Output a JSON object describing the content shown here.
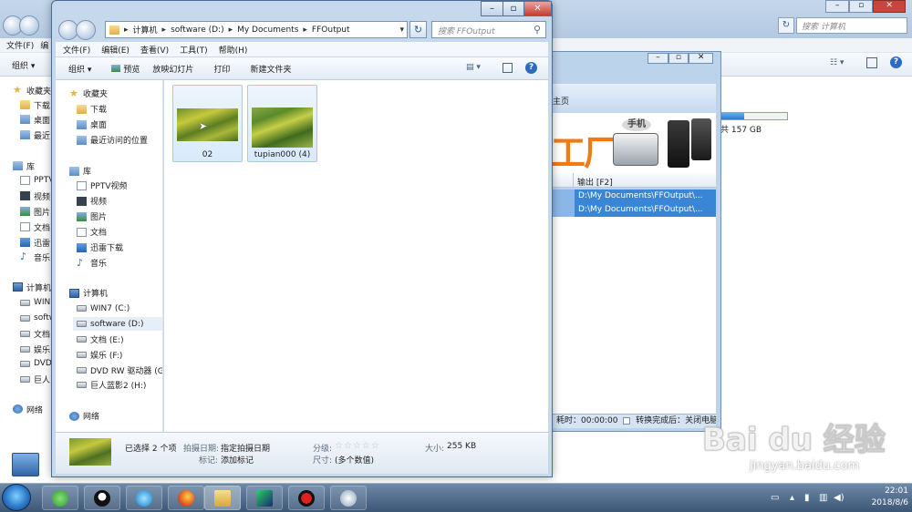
{
  "bg_window": {
    "menu": [
      "文件(F)",
      "编"
    ],
    "toolbar_org": "组织 ▾",
    "search_placeholder": "搜索 计算机",
    "sidebar": [
      "收藏夹",
      "下载",
      "桌面",
      "最近",
      "库",
      "PPTV",
      "视频",
      "图片",
      "文档",
      "迅雷",
      "音乐",
      "计算机",
      "WIN",
      "softw",
      "文档",
      "娱乐",
      "DVD",
      "巨人",
      "网络"
    ],
    "capacity": "共 157 GB"
  },
  "app": {
    "home": "主页",
    "banner_text": "工厂",
    "banner_phone_label": "手机",
    "output_header": "输出 [F2]",
    "rows": [
      "D:\\My Documents\\FFOutput\\...",
      "D:\\My Documents\\FFOutput\\..."
    ],
    "status_time": "耗时：00:00:00",
    "status_after": "转换完成后：关闭电脑"
  },
  "explorer": {
    "address": [
      "计算机",
      "software (D:)",
      "My Documents",
      "FFOutput"
    ],
    "search_placeholder": "搜索 FFOutput",
    "menu": [
      "文件(F)",
      "编辑(E)",
      "查看(V)",
      "工具(T)",
      "帮助(H)"
    ],
    "toolbar": {
      "organize": "组织 ▾",
      "preview": "预览",
      "slideshow": "放映幻灯片",
      "print": "打印",
      "new_folder": "新建文件夹"
    },
    "favorites": {
      "header": "收藏夹",
      "items": [
        "下载",
        "桌面",
        "最近访问的位置"
      ]
    },
    "libraries": {
      "header": "库",
      "items": [
        "PPTV视频",
        "视频",
        "图片",
        "文档",
        "迅雷下载",
        "音乐"
      ]
    },
    "computer": {
      "header": "计算机",
      "items": [
        "WIN7 (C:)",
        "software (D:)",
        "文档 (E:)",
        "娱乐 (F:)",
        "DVD RW 驱动器 (G",
        "巨人蓝影2 (H:)"
      ]
    },
    "network": "网络",
    "files": [
      {
        "name": "02"
      },
      {
        "name": "tupian000 (4)"
      }
    ],
    "details": {
      "selected": "已选择 2 个项",
      "date_label": "拍摄日期:",
      "date_value": "指定拍摄日期",
      "tag_label": "标记:",
      "tag_value": "添加标记",
      "rating_label": "分级:",
      "rating": 0,
      "size_label": "尺寸:",
      "size_value": "(多个数值)",
      "filesize_label": "大小:",
      "filesize_value": "255 KB"
    }
  },
  "taskbar": {
    "time": "22:01",
    "date": "2018/8/6"
  },
  "watermark": {
    "brand": "Bai du 经验",
    "url": "jingyan.baidu.com"
  }
}
